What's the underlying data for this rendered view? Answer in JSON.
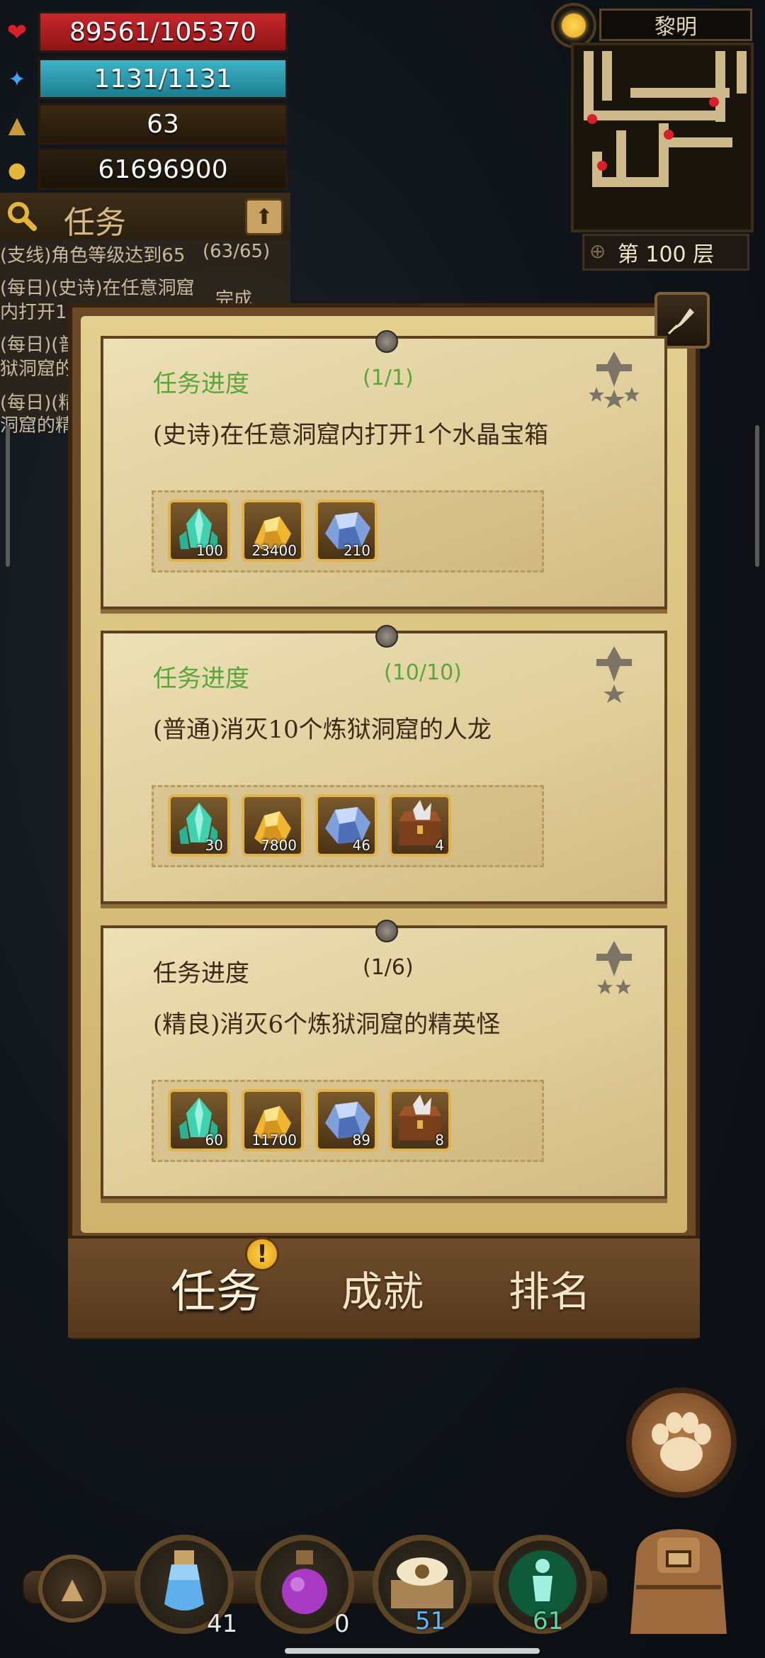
{
  "stats": {
    "hp": "89561/105370",
    "mp": "1131/1131",
    "level": "63",
    "gold": "61696900"
  },
  "tracker": {
    "title": "任务",
    "lines": [
      {
        "text": "(支线)角色等级达到65",
        "progress": "(63/65)"
      },
      {
        "text": "(每日)(史诗)在任意洞窟",
        "line2": "内打开1",
        "status": "完成"
      },
      {
        "text": "(每日)(普",
        "line2": "狱洞窟的"
      },
      {
        "text": "(每日)(精",
        "line2": "洞窟的精"
      }
    ]
  },
  "map": {
    "time_of_day": "黎明",
    "floor": "第 100 层"
  },
  "quests": [
    {
      "progress_label": "任务进度",
      "progress_count": "(1/1)",
      "description": "(史诗)在任意洞窟内打开1个水晶宝箱",
      "complete": true,
      "rewards": [
        {
          "icon": "crystal-icon",
          "qty": "100"
        },
        {
          "icon": "gold-icon",
          "qty": "23400"
        },
        {
          "icon": "ore-icon",
          "qty": "210"
        }
      ]
    },
    {
      "progress_label": "任务进度",
      "progress_count": "(10/10)",
      "description": "(普通)消灭10个炼狱洞窟的人龙",
      "complete": true,
      "rewards": [
        {
          "icon": "crystal-icon",
          "qty": "30"
        },
        {
          "icon": "gold-icon",
          "qty": "7800"
        },
        {
          "icon": "ore-icon",
          "qty": "46"
        },
        {
          "icon": "chest-icon",
          "qty": "4"
        }
      ]
    },
    {
      "progress_label": "任务进度",
      "progress_count": "(1/6)",
      "description": "(精良)消灭6个炼狱洞窟的精英怪",
      "complete": false,
      "rewards": [
        {
          "icon": "crystal-icon",
          "qty": "60"
        },
        {
          "icon": "gold-icon",
          "qty": "11700"
        },
        {
          "icon": "ore-icon",
          "qty": "89"
        },
        {
          "icon": "chest-icon",
          "qty": "8"
        }
      ]
    }
  ],
  "tabs": {
    "quests": "任务",
    "achievements": "成就",
    "ranking": "排名",
    "alert": "!"
  },
  "bottom": {
    "potion_blue": "41",
    "potion_purple": "0",
    "scroll": "51",
    "skill": "61"
  },
  "colors": {
    "complete_green": "#5aa63a",
    "incomplete_dark": "#3b2a17"
  }
}
